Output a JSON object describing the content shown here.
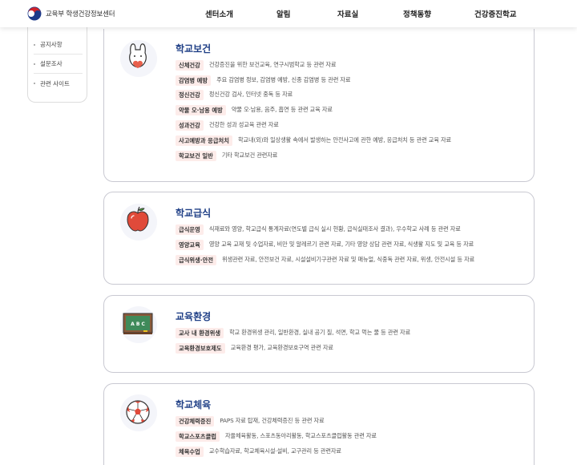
{
  "header": {
    "site_name": "교육부 학생건강정보센터",
    "nav": [
      "센터소개",
      "알림",
      "자료실",
      "정책동향",
      "건강증진학교"
    ]
  },
  "sidebar": {
    "items": [
      "공지사항",
      "설문조사",
      "관련 사이트"
    ]
  },
  "categories": [
    {
      "title": "학교보건",
      "icon": "heart-character-icon",
      "rows": [
        {
          "tag": "신체건강",
          "desc": "건강증진을 위한 보건교육, 연구시범학교 등 관련 자료"
        },
        {
          "tag": "감염병 예방",
          "desc": "주요 감염병 정보, 감염병 예방, 신종 감염병 등 관련 자료"
        },
        {
          "tag": "정신건강",
          "desc": "정신건강 검사, 인터넷 중독 등 자료"
        },
        {
          "tag": "약물 오·남용 예방",
          "desc": "약물 오·남용, 음주, 흡연 등 관련 교육 자료"
        },
        {
          "tag": "성과건강",
          "desc": "건강한 성과 성교육 관련 자료"
        },
        {
          "tag": "사고예방과 응급처치",
          "desc": "학교내(외)와 일상생활 속에서 발생하는 안전사고에 관한 예방, 응급처치 등 관련 교육 자료"
        },
        {
          "tag": "학교보건 일반",
          "desc": "기타 학교보건 관련자료"
        }
      ]
    },
    {
      "title": "학교급식",
      "icon": "apple-icon",
      "rows": [
        {
          "tag": "급식운영",
          "desc": "식재료와 영양, 학교급식 통계자료(연도별 급식 실시 현황, 급식실태조사 결과), 우수학교 사례 등 관련 자료"
        },
        {
          "tag": "영양교육",
          "desc": "영양 교육 교재 및 수업자료, 비만 및 알레르기 관련 자료, 기타 영양 상담 관련 자료, 식생활 지도 및 교육 등 자료"
        },
        {
          "tag": "급식위생·안전",
          "desc": "위생관련 자료, 안전보건 자료, 시설설비기구관련 자료 및 매뉴얼, 식중독 관련 자료, 위생, 안전시설 등 자료"
        }
      ]
    },
    {
      "title": "교육환경",
      "icon": "chalkboard-icon",
      "icon_text": "A B C",
      "rows": [
        {
          "tag": "교사 내 환경위생",
          "desc": "학교 환경위생 관리, 일반환경, 실내 공기 질, 석면, 학교 먹는 물 등 관련 자료"
        },
        {
          "tag": "교육환경보호제도",
          "desc": "교육환경 평가, 교육환경보호구역 관련 자료"
        }
      ]
    },
    {
      "title": "학교체육",
      "icon": "soccer-ball-icon",
      "rows": [
        {
          "tag": "건강체력증진",
          "desc": "PAPS 자료 탑재, 건강체력증진 등 관련 자료"
        },
        {
          "tag": "학교스포츠클럽",
          "desc": "자율체육활동, 스포츠동아리활동, 학교스포츠클럽활동 관련 자료"
        },
        {
          "tag": "체육수업",
          "desc": "교수학습자료, 학교체육시설·설비, 교구관리 등 관련자료"
        }
      ]
    }
  ],
  "colors": {
    "title": "#1f3f86",
    "tag_bg": "#fdecea",
    "card_border": "#c9c9d2"
  }
}
